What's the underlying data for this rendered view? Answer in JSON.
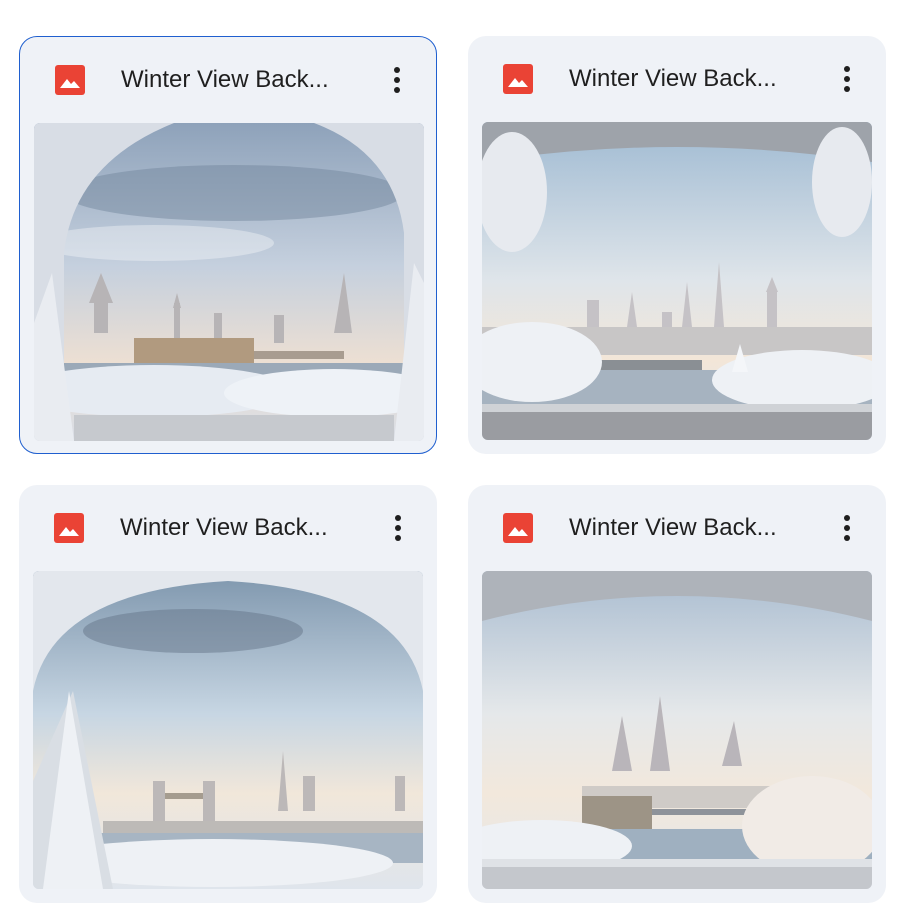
{
  "files": [
    {
      "name": "Winter View Back...",
      "icon": "image-file-icon",
      "menu_icon": "more-vert-icon",
      "selected": true
    },
    {
      "name": "Winter View Back...",
      "icon": "image-file-icon",
      "menu_icon": "more-vert-icon",
      "selected": false
    },
    {
      "name": "Winter View Back...",
      "icon": "image-file-icon",
      "menu_icon": "more-vert-icon",
      "selected": false
    },
    {
      "name": "Winter View Back...",
      "icon": "image-file-icon",
      "menu_icon": "more-vert-icon",
      "selected": false
    }
  ],
  "colors": {
    "card_bg": "#eff2f7",
    "selected_border": "#1f5fcf",
    "icon_red": "#ea4335",
    "text": "#1f1f1f"
  }
}
